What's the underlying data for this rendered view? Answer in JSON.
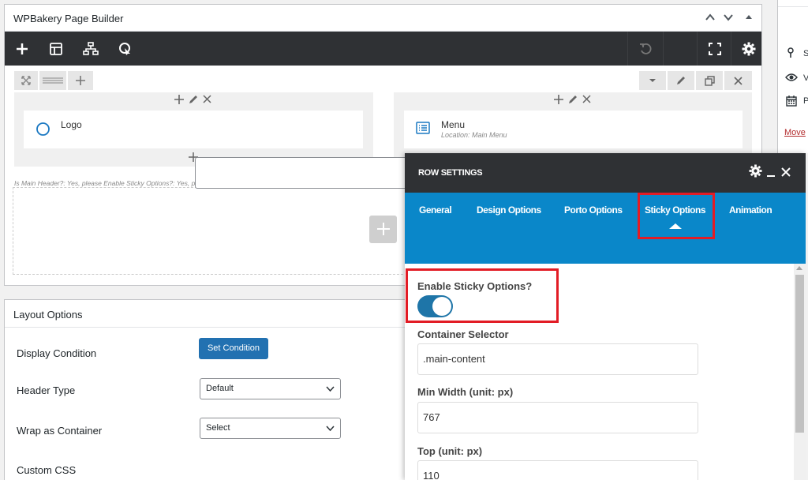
{
  "builder": {
    "title": "WPBakery Page Builder"
  },
  "row": {
    "info": "Is Main Header?: Yes, please  Enable Sticky Options?: Yes, please"
  },
  "columns": [
    {
      "element_title": "Logo",
      "element_sub": ""
    },
    {
      "element_title": "Menu",
      "element_sub": "Location: Main Menu"
    }
  ],
  "layout_options": {
    "title": "Layout Options",
    "fields": [
      {
        "label": "Display Condition"
      },
      {
        "label": "Header Type",
        "value": "Default"
      },
      {
        "label": "Wrap as Container",
        "value": "Select"
      },
      {
        "label": "Custom CSS"
      }
    ],
    "set_condition_label": "Set Condition"
  },
  "publish": {
    "letters": [
      "S",
      "V",
      "P"
    ],
    "move_link": "Move"
  },
  "panel": {
    "title": "ROW SETTINGS",
    "tabs": [
      "General",
      "Design Options",
      "Porto Options",
      "Sticky Options",
      "Animation"
    ],
    "active_tab": "Sticky Options",
    "fields": {
      "enable_sticky_label": "Enable Sticky Options?",
      "enable_sticky_on": true,
      "container_selector_label": "Container Selector",
      "container_selector_value": ".main-content",
      "min_width_label": "Min Width (unit: px)",
      "min_width_value": "767",
      "top_label": "Top (unit: px)",
      "top_value": "110"
    }
  },
  "colors": {
    "toolbar": "#2f3134",
    "tab_bar": "#0a87c9",
    "highlight": "#e21c25",
    "primary_button": "#2271b1"
  }
}
